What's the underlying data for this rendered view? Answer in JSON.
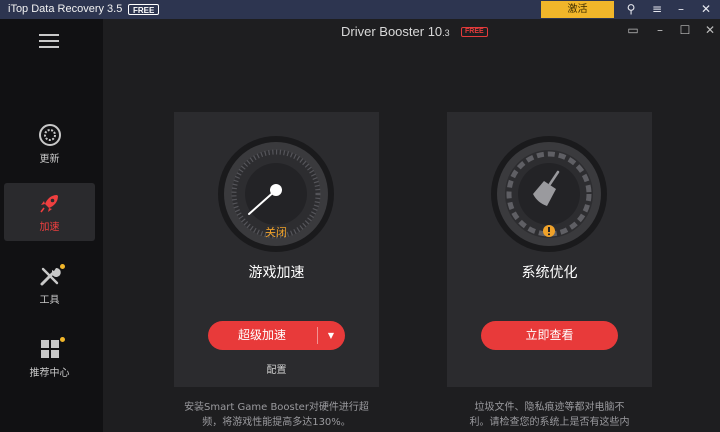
{
  "outer_window": {
    "title": "iTop Data Recovery 3.5",
    "badge": "FREE",
    "activate_label": "激活"
  },
  "app": {
    "title": "Driver Booster 10",
    "title_suffix": ".3",
    "badge": "FREE"
  },
  "sidebar": {
    "items": [
      {
        "label": "更新",
        "icon": "update-icon"
      },
      {
        "label": "加速",
        "icon": "rocket-icon",
        "active": true
      },
      {
        "label": "工具",
        "icon": "tools-icon"
      },
      {
        "label": "推荐中心",
        "icon": "grid-icon"
      }
    ]
  },
  "cards": [
    {
      "title": "游戏加速",
      "gauge_status": "关闭",
      "button_label": "超级加速",
      "secondary_link": "配置",
      "description_line1": "安装Smart Game Booster对硬件进行超",
      "description_line2": "频，将游戏性能提高多达130%。"
    },
    {
      "title": "系统优化",
      "button_label": "立即查看",
      "description_line1": "垃圾文件、隐私痕迹等都对电脑不",
      "description_line2": "利。请检查您的系统上是否有这些内"
    }
  ],
  "colors": {
    "accent_red": "#e83a3a",
    "status_orange": "#f0a22a",
    "activate_yellow": "#f1b62a"
  }
}
